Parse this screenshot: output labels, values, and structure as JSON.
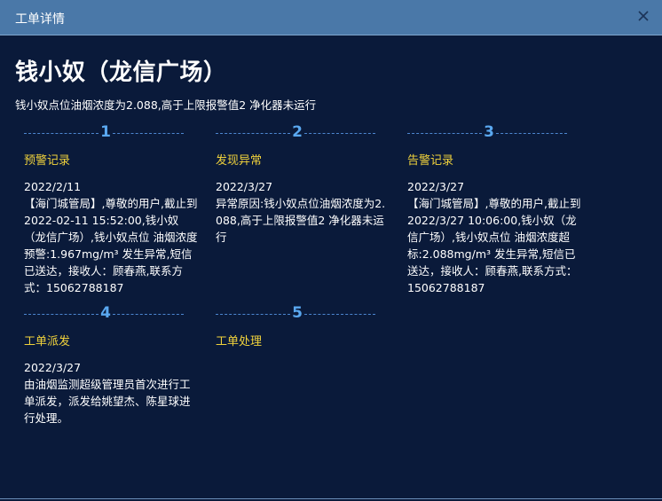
{
  "window": {
    "title": "工单详情",
    "close_icon": "close-icon"
  },
  "header": {
    "title": "钱小奴（龙信广场）",
    "subtitle": "钱小奴点位油烟浓度为2.088,高于上限报警值2 净化器未运行"
  },
  "colors": {
    "titlebar": "#4a78a8",
    "background": "#0a1a3a",
    "step_number": "#5aa8f0",
    "step_name": "#f0d23c",
    "text": "#ffffff"
  },
  "steps": [
    {
      "number": "1",
      "name": "预警记录",
      "date": "2022/2/11",
      "body": "【海门城管局】,尊敬的用户,截止到2022-02-11 15:52:00,钱小奴（龙信广场）,钱小奴点位 油烟浓度预警:1.967mg/m³ 发生异常,短信已送达，接收人：顾春燕,联系方式：15062788187"
    },
    {
      "number": "2",
      "name": "发现异常",
      "date": "2022/3/27",
      "body": "异常原因:钱小奴点位油烟浓度为2.088,高于上限报警值2 净化器未运行"
    },
    {
      "number": "3",
      "name": "告警记录",
      "date": "2022/3/27",
      "body": "【海门城管局】,尊敬的用户,截止到2022/3/27 10:06:00,钱小奴（龙信广场）,钱小奴点位 油烟浓度超标:2.088mg/m³ 发生异常,短信已送达，接收人：顾春燕,联系方式：15062788187"
    },
    {
      "number": "4",
      "name": "工单派发",
      "date": "2022/3/27",
      "body": "由油烟监测超级管理员首次进行工单派发，派发给姚望杰、陈星球进行处理。"
    },
    {
      "number": "5",
      "name": "工单处理",
      "date": "",
      "body": ""
    }
  ]
}
